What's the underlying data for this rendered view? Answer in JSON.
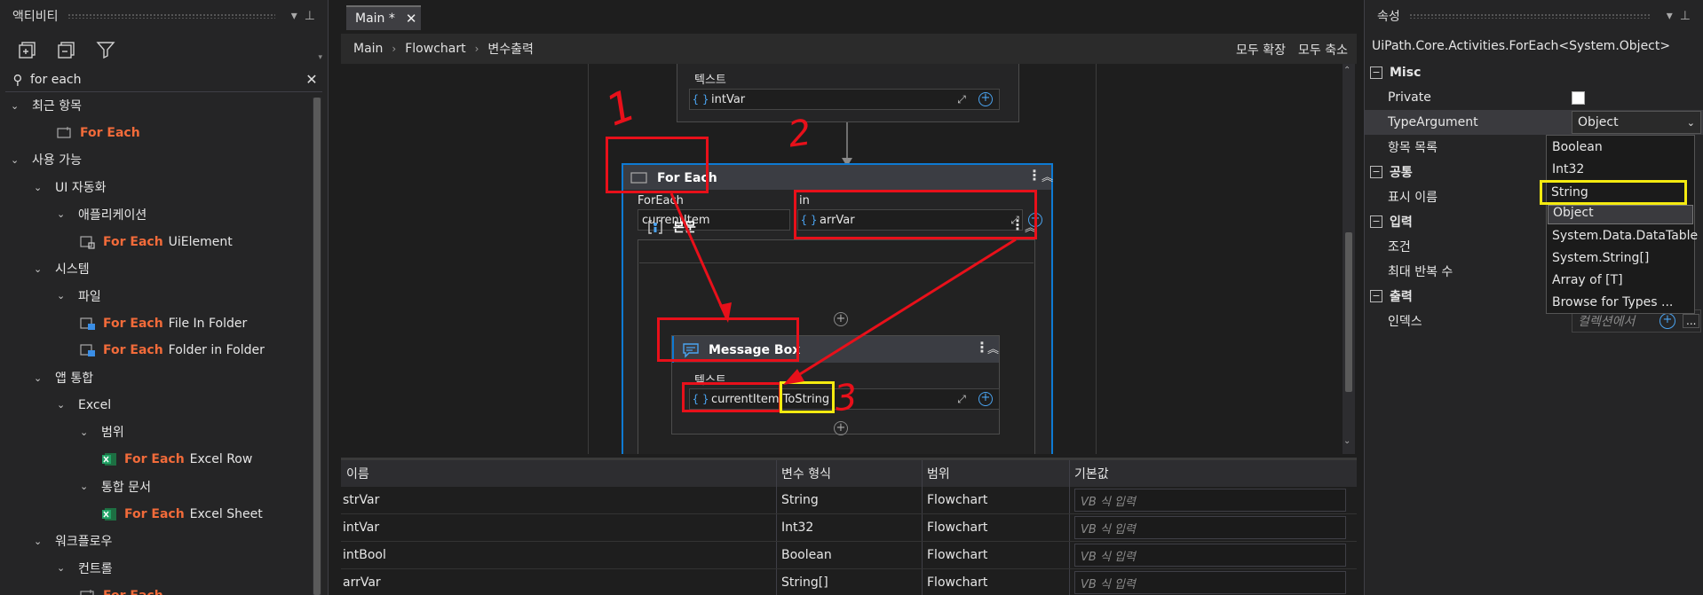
{
  "activities": {
    "title": "액티비티",
    "search_value": "for each",
    "tree": [
      {
        "label": "최근 항목",
        "level": 0,
        "chev": "⌄"
      },
      {
        "fe": "For Each",
        "label": "",
        "level": 2,
        "icon": "foreach-icon"
      },
      {
        "label": "사용 가능",
        "level": 0,
        "chev": "⌄"
      },
      {
        "label": "UI 자동화",
        "level": 1,
        "chev": "⌄"
      },
      {
        "label": "애플리케이션",
        "level": 2,
        "chev": "⌄"
      },
      {
        "fe": "For Each",
        "label": "UiElement",
        "level": 3,
        "icon": "foreach-ui-icon"
      },
      {
        "label": "시스템",
        "level": 1,
        "chev": "⌄"
      },
      {
        "label": "파일",
        "level": 2,
        "chev": "⌄"
      },
      {
        "fe": "For Each",
        "label": "File In Folder",
        "level": 3,
        "icon": "foreach-file-icon"
      },
      {
        "fe": "For Each",
        "label": "Folder in Folder",
        "level": 3,
        "icon": "foreach-folder-icon"
      },
      {
        "label": "앱 통합",
        "level": 1,
        "chev": "⌄"
      },
      {
        "label": "Excel",
        "level": 2,
        "chev": "⌄"
      },
      {
        "label": "범위",
        "level": 3,
        "chev": "⌄"
      },
      {
        "fe": "For Each",
        "label": "Excel Row",
        "level": 4,
        "icon": "excel-icon"
      },
      {
        "label": "통합 문서",
        "level": 3,
        "chev": "⌄"
      },
      {
        "fe": "For Each",
        "label": "Excel Sheet",
        "level": 4,
        "icon": "excel-icon"
      },
      {
        "label": "워크플로우",
        "level": 1,
        "chev": "⌄"
      },
      {
        "label": "컨트롤",
        "level": 2,
        "chev": "⌄"
      },
      {
        "fe": "For Each",
        "label": "",
        "level": 3,
        "icon": "foreach-icon"
      }
    ]
  },
  "designer": {
    "tab_label": "Main *",
    "breadcrumb": [
      "Main",
      "Flowchart",
      "변수출력"
    ],
    "expand_all": "모두 확장",
    "collapse_all": "모두 축소",
    "top_activity": {
      "text_label": "텍스트",
      "value": "intVar"
    },
    "foreach": {
      "title": "For Each",
      "foreach_label": "ForEach",
      "item_value": "currentItem",
      "in_label": "in",
      "in_value": "arrVar",
      "body_title": "본문"
    },
    "message_box": {
      "title": "Message Box",
      "text_label": "텍스트",
      "value_a": "currentItem.",
      "value_b": "ToString"
    },
    "annotations": [
      "1",
      "2",
      "3"
    ]
  },
  "variables": {
    "columns": [
      "이름",
      "변수 형식",
      "범위",
      "기본값"
    ],
    "placeholder": "VB 식 입력",
    "rows": [
      {
        "name": "strVar",
        "type": "String",
        "scope": "Flowchart"
      },
      {
        "name": "intVar",
        "type": "Int32",
        "scope": "Flowchart"
      },
      {
        "name": "intBool",
        "type": "Boolean",
        "scope": "Flowchart"
      },
      {
        "name": "arrVar",
        "type": "String[]",
        "scope": "Flowchart"
      }
    ]
  },
  "properties": {
    "title": "속성",
    "type_name": "UiPath.Core.Activities.ForEach<System.Object>",
    "rows": [
      {
        "kind": "cat",
        "label": "Misc"
      },
      {
        "kind": "prop",
        "label": "Private",
        "value": "checkbox"
      },
      {
        "kind": "prop",
        "label": "TypeArgument",
        "value": "Object"
      },
      {
        "kind": "prop",
        "label": "항목 목록",
        "value": ""
      },
      {
        "kind": "cat",
        "label": "공통"
      },
      {
        "kind": "prop",
        "label": "표시 이름",
        "value": ""
      },
      {
        "kind": "cat",
        "label": "입력"
      },
      {
        "kind": "prop",
        "label": "조건",
        "value": ""
      },
      {
        "kind": "prop",
        "label": "최대 반복 수",
        "value": ""
      },
      {
        "kind": "cat",
        "label": "출력"
      },
      {
        "kind": "prop",
        "label": "인덱스",
        "value": "컬렉션에서"
      }
    ],
    "dropdown_options": [
      "Boolean",
      "Int32",
      "String",
      "Object",
      "System.Data.DataTable",
      "System.String[]",
      "Array of [T]",
      "Browse for Types ..."
    ],
    "selected_option": "Object",
    "highlighted_option": "String"
  },
  "colors": {
    "accent": "#0e7ad3",
    "foreach_orange": "#f26b3a",
    "annotation_red": "#e8101a",
    "highlight_yellow": "#f4ea10"
  }
}
